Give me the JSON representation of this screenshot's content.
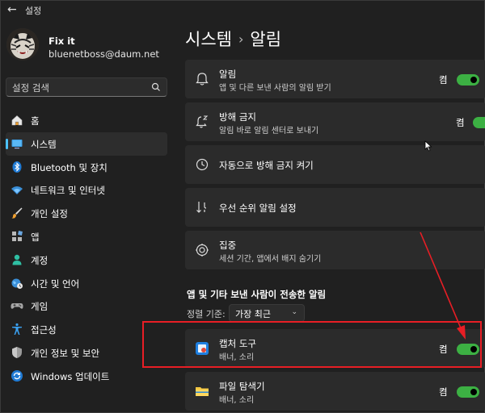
{
  "window": {
    "title": "설정",
    "back_glyph": "←"
  },
  "profile": {
    "name": "Fix it",
    "email": "bluenetboss@daum.net"
  },
  "search": {
    "placeholder": "설정 검색"
  },
  "sidebar": {
    "items": [
      {
        "label": "홈",
        "icon": "home-icon"
      },
      {
        "label": "시스템",
        "icon": "system-icon",
        "active": true
      },
      {
        "label": "Bluetooth 및 장치",
        "icon": "bluetooth-icon"
      },
      {
        "label": "네트워크 및 인터넷",
        "icon": "network-icon"
      },
      {
        "label": "개인 설정",
        "icon": "brush-icon"
      },
      {
        "label": "앱",
        "icon": "apps-icon"
      },
      {
        "label": "계정",
        "icon": "account-icon"
      },
      {
        "label": "시간 및 언어",
        "icon": "globe-clock-icon"
      },
      {
        "label": "게임",
        "icon": "gamepad-icon"
      },
      {
        "label": "접근성",
        "icon": "accessibility-icon"
      },
      {
        "label": "개인 정보 및 보안",
        "icon": "shield-icon"
      },
      {
        "label": "Windows 업데이트",
        "icon": "update-icon"
      }
    ]
  },
  "breadcrumb": {
    "parent": "시스템",
    "separator": "›",
    "current": "알림"
  },
  "cards": {
    "notifications": {
      "title": "알림",
      "subtitle": "앱 및 다른 보낸 사람의 알림 받기",
      "toggle_label": "켬",
      "on": true
    },
    "dnd": {
      "title": "방해 금지",
      "subtitle": "알림 바로 알림 센터로 보내기",
      "toggle_label": "켬",
      "on": true
    },
    "auto_dnd": {
      "title": "자동으로 방해 금지 켜기"
    },
    "priority": {
      "title": "우선 순위 알림 설정"
    },
    "focus": {
      "title": "집중",
      "subtitle": "세션 기간, 앱에서 배지 숨기기"
    }
  },
  "apps_section": {
    "title": "앱 및 기타 보낸 사람이 전송한 알림",
    "sort_label": "정렬 기준:",
    "sort_value": "가장 최근",
    "apps": [
      {
        "name": "캡처 도구",
        "subtitle": "배너, 소리",
        "toggle_label": "켬",
        "on": true,
        "icon": "snipping-tool-icon"
      },
      {
        "name": "파일 탐색기",
        "subtitle": "배너, 소리",
        "toggle_label": "켬",
        "on": true,
        "icon": "file-explorer-icon"
      }
    ]
  },
  "colors": {
    "accent": "#4cc2ff",
    "toggle_on": "#3cb043",
    "annotation": "#e81e25",
    "background": "#202020",
    "card": "#2b2b2b"
  }
}
